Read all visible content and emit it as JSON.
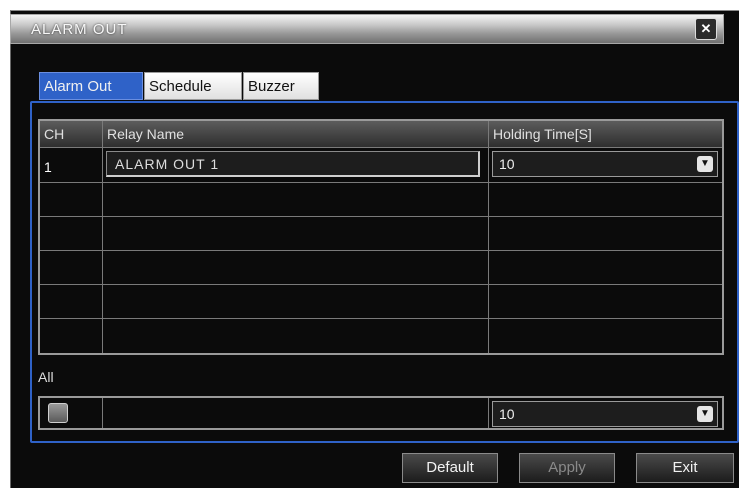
{
  "window": {
    "title": "ALARM OUT",
    "close_label": "✕"
  },
  "tabs": [
    {
      "label": "Alarm Out",
      "active": true
    },
    {
      "label": "Schedule",
      "active": false
    },
    {
      "label": "Buzzer",
      "active": false
    }
  ],
  "table": {
    "columns": [
      "CH",
      "Relay Name",
      "Holding Time[S]"
    ],
    "rows": [
      {
        "ch": "1",
        "relay_name": "ALARM OUT 1",
        "holding_time": "10"
      }
    ]
  },
  "all": {
    "label": "All",
    "holding_time": "10"
  },
  "buttons": {
    "default": "Default",
    "apply": "Apply",
    "exit": "Exit"
  },
  "colors": {
    "accent": "#2f62c8",
    "background": "#0b0b0b"
  },
  "icons": {
    "close": "close-icon",
    "dropdown": "chevron-down-icon",
    "checkbox": "checkbox-icon"
  }
}
